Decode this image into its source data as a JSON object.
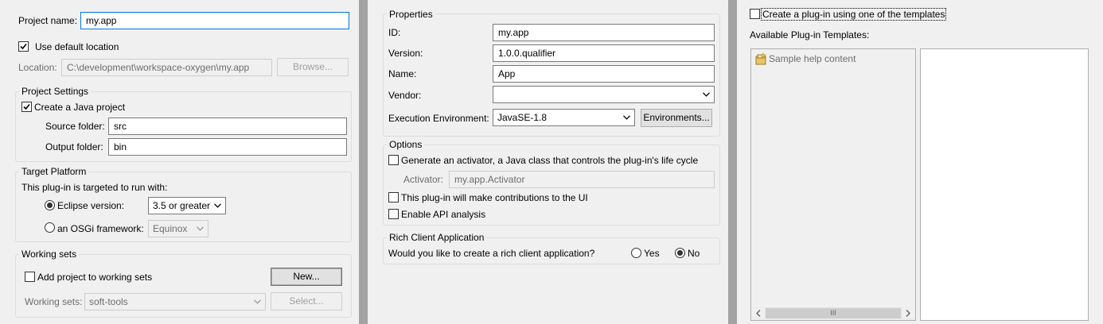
{
  "left": {
    "project_name_label": "Project name:",
    "project_name_value": "my.app",
    "use_default_location_label": "Use default location",
    "location_label": "Location:",
    "location_value": "C:\\development\\workspace-oxygen\\my.app",
    "browse_button": "Browse...",
    "project_settings": {
      "title": "Project Settings",
      "create_java_label": "Create a Java project",
      "source_folder_label": "Source folder:",
      "source_folder_value": "src",
      "output_folder_label": "Output folder:",
      "output_folder_value": "bin"
    },
    "target_platform": {
      "title": "Target Platform",
      "description": "This plug-in is targeted to run with:",
      "eclipse_label": "Eclipse version:",
      "eclipse_value": "3.5 or greater",
      "osgi_label": "an OSGi framework:",
      "osgi_value": "Equinox"
    },
    "working_sets": {
      "title": "Working sets",
      "add_label": "Add project to working sets",
      "new_button": "New...",
      "sets_label": "Working sets:",
      "sets_value": "soft-tools",
      "select_button": "Select..."
    }
  },
  "middle": {
    "properties": {
      "title": "Properties",
      "id_label": "ID:",
      "id_value": "my.app",
      "version_label": "Version:",
      "version_value": "1.0.0.qualifier",
      "name_label": "Name:",
      "name_value": "App",
      "vendor_label": "Vendor:",
      "vendor_value": "",
      "exec_env_label": "Execution Environment:",
      "exec_env_value": "JavaSE-1.8",
      "environments_button": "Environments..."
    },
    "options": {
      "title": "Options",
      "generate_activator_label": "Generate an activator, a Java class that controls the plug-in's life cycle",
      "activator_label": "Activator:",
      "activator_value": "my.app.Activator",
      "ui_contrib_label": "This plug-in will make contributions to the UI",
      "api_analysis_label": "Enable API analysis"
    },
    "rca": {
      "title": "Rich Client Application",
      "question": "Would you like to create a rich client application?",
      "yes_label": "Yes",
      "no_label": "No"
    }
  },
  "right": {
    "create_from_template_label": "Create a plug-in using one of the templates",
    "available_templates_label": "Available Plug-in Templates:",
    "templates": [
      "Sample help content"
    ],
    "scrollbar_thumb_glyph": "III"
  },
  "icons": {
    "checkbox_checked": "check-icon",
    "template_item": "template-wizard-icon",
    "combo_arrow": "chevron-down-icon"
  }
}
